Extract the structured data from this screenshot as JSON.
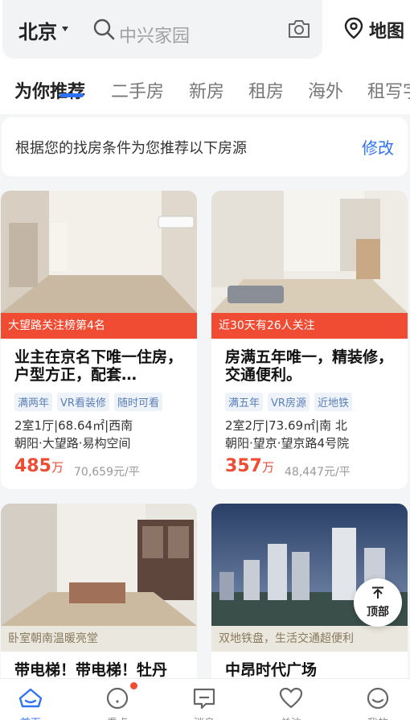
{
  "search": {
    "city": "北京",
    "placeholder": "中兴家园",
    "map_label": "地图"
  },
  "tabs": [
    {
      "label": "为你推荐",
      "active": true
    },
    {
      "label": "二手房",
      "active": false
    },
    {
      "label": "新房",
      "active": false
    },
    {
      "label": "租房",
      "active": false
    },
    {
      "label": "海外",
      "active": false
    },
    {
      "label": "租写字楼",
      "active": false
    }
  ],
  "recommend": {
    "text": "根据您的找房条件为您推荐以下房源",
    "edit_label": "修改"
  },
  "listings": [
    {
      "tag": "大望路关注榜第4名",
      "title": "业主在京名下唯一住房，户型方正，配套…",
      "chips": [
        "满两年",
        "VR看装修",
        "随时可看"
      ],
      "spec": "2室1厅|68.64㎡|西南",
      "location": "朝阳·大望路·易构空间",
      "price": "485",
      "price_unit": "万",
      "unit_price": "70,659元/平"
    },
    {
      "tag": "近30天有26人关注",
      "title": "房满五年唯一，精装修，交通便利。",
      "chips": [
        "满五年",
        "VR房源",
        "近地铁"
      ],
      "spec": "2室2厅|73.69㎡|南 北",
      "location": "朝阳·望京·望京路4号院",
      "price": "357",
      "price_unit": "万",
      "unit_price": "48,447元/平"
    },
    {
      "tag": "卧室朝南温暖亮堂",
      "title": "带电梯！带电梯！牡丹"
    },
    {
      "tag": "双地铁盘，生活交通超便利",
      "title": "中昂时代广场"
    }
  ],
  "to_top_label": "顶部",
  "bottom_nav": [
    {
      "label": "首页",
      "icon": "home-icon",
      "active": true
    },
    {
      "label": "看点",
      "icon": "discover-icon",
      "active": false,
      "badge": true
    },
    {
      "label": "消息",
      "icon": "message-icon",
      "active": false
    },
    {
      "label": "关注",
      "icon": "heart-icon",
      "active": false
    },
    {
      "label": "我的",
      "icon": "profile-icon",
      "active": false
    }
  ],
  "colors": {
    "accent": "#3072f6",
    "price": "#f04b33",
    "tag_red": "#f04b33",
    "tag_beige": "#eae7de"
  }
}
